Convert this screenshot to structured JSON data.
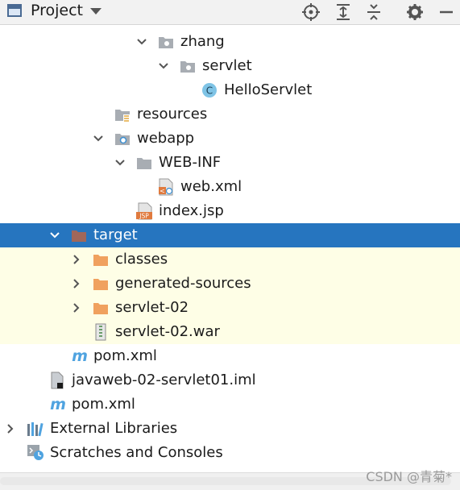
{
  "toolbar": {
    "title": "Project",
    "icons": [
      "locate-icon",
      "expand-all-icon",
      "collapse-all-icon",
      "gear-icon",
      "minimize-icon"
    ]
  },
  "tree": [
    {
      "label": "zhang",
      "icon": "package-icon",
      "arrow": "down"
    },
    {
      "label": "servlet",
      "icon": "package-icon",
      "arrow": "down"
    },
    {
      "label": "HelloServlet",
      "icon": "java-class-icon",
      "arrow": ""
    },
    {
      "label": "resources",
      "icon": "resources-folder-icon",
      "arrow": ""
    },
    {
      "label": "webapp",
      "icon": "web-folder-icon",
      "arrow": "down"
    },
    {
      "label": "WEB-INF",
      "icon": "folder-icon",
      "arrow": "down"
    },
    {
      "label": "web.xml",
      "icon": "xml-file-icon",
      "arrow": ""
    },
    {
      "label": "index.jsp",
      "icon": "jsp-file-icon",
      "arrow": ""
    },
    {
      "label": "target",
      "icon": "excluded-folder-icon",
      "arrow": "down"
    },
    {
      "label": "classes",
      "icon": "orange-folder-icon",
      "arrow": "right"
    },
    {
      "label": "generated-sources",
      "icon": "orange-folder-icon",
      "arrow": "right"
    },
    {
      "label": "servlet-02",
      "icon": "orange-folder-icon",
      "arrow": "right"
    },
    {
      "label": "servlet-02.war",
      "icon": "archive-icon",
      "arrow": ""
    },
    {
      "label": "pom.xml",
      "icon": "maven-icon",
      "arrow": ""
    },
    {
      "label": "javaweb-02-servlet01.iml",
      "icon": "iml-file-icon",
      "arrow": ""
    },
    {
      "label": "pom.xml",
      "icon": "maven-icon",
      "arrow": ""
    },
    {
      "label": "External Libraries",
      "icon": "libraries-icon",
      "arrow": "right"
    },
    {
      "label": "Scratches and Consoles",
      "icon": "scratches-icon",
      "arrow": ""
    }
  ],
  "watermark": "CSDN @青菊*",
  "colors": {
    "selection": "#2675bf",
    "highlight": "#fefee6",
    "orange_folder": "#f0a15e",
    "gray_folder": "#a8adb3",
    "excluded_folder": "#a0675a"
  }
}
